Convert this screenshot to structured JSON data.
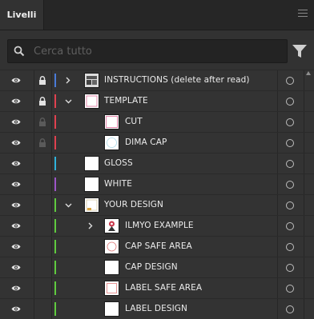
{
  "panel": {
    "tab_label": "Livelli",
    "menu_icon": "hamburger-menu-icon"
  },
  "search": {
    "placeholder": "Cerca tutto",
    "value": "",
    "icon": "search-icon",
    "filter_icon": "filter-icon"
  },
  "colors": {
    "blue": "#4a7bd8",
    "red": "#e0414f",
    "cyan": "#2fb3dc",
    "purple": "#9d55c8",
    "green": "#5fcb3f"
  },
  "layers": [
    {
      "name": "INSTRUCTIONS (delete after read)",
      "color": "blue",
      "locked": true,
      "lock_dim": false,
      "expanded": false,
      "has_chevron": true,
      "level": 0,
      "thumb": "instructions"
    },
    {
      "name": "TEMPLATE",
      "color": "red",
      "locked": true,
      "lock_dim": false,
      "expanded": true,
      "has_chevron": true,
      "level": 0,
      "thumb": "template"
    },
    {
      "name": "CUT",
      "color": "red",
      "locked": true,
      "lock_dim": true,
      "has_chevron": false,
      "level": 1,
      "thumb": "cut"
    },
    {
      "name": "DIMA CAP",
      "color": "red",
      "locked": true,
      "lock_dim": true,
      "has_chevron": false,
      "level": 1,
      "thumb": "dima"
    },
    {
      "name": "GLOSS",
      "color": "cyan",
      "locked": false,
      "has_chevron": false,
      "level": 0,
      "thumb": "blank"
    },
    {
      "name": "WHITE",
      "color": "purple",
      "locked": false,
      "has_chevron": false,
      "level": 0,
      "thumb": "blank"
    },
    {
      "name": "YOUR DESIGN",
      "color": "green",
      "locked": false,
      "expanded": true,
      "has_chevron": true,
      "level": 0,
      "thumb": "design"
    },
    {
      "name": "ILMYO EXAMPLE",
      "color": "green",
      "locked": false,
      "expanded": false,
      "has_chevron": true,
      "level": 1,
      "thumb": "example"
    },
    {
      "name": "CAP SAFE AREA",
      "color": "green",
      "locked": false,
      "has_chevron": false,
      "level": 1,
      "thumb": "cap-safe"
    },
    {
      "name": "CAP DESIGN",
      "color": "green",
      "locked": false,
      "has_chevron": false,
      "level": 1,
      "thumb": "blank"
    },
    {
      "name": "LABEL SAFE AREA",
      "color": "green",
      "locked": false,
      "has_chevron": false,
      "level": 1,
      "thumb": "label-safe"
    },
    {
      "name": "LABEL DESIGN",
      "color": "green",
      "locked": false,
      "has_chevron": false,
      "level": 1,
      "thumb": "blank"
    }
  ]
}
